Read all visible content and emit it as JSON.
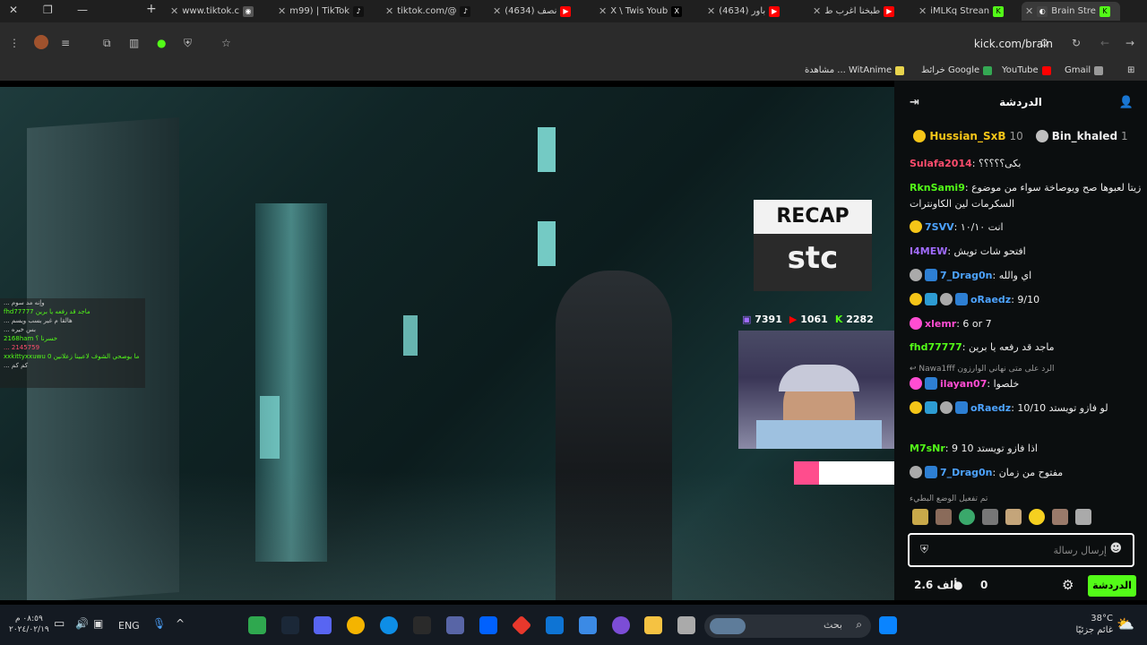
{
  "tabs": [
    {
      "title": "www.tiktok.c",
      "icon": "tiktok-icon"
    },
    {
      "title": "m99) | TikTok",
      "icon": "tiktok-icon"
    },
    {
      "title": "tiktok.com/@",
      "icon": "tiktok-icon"
    },
    {
      "title": "(4634) نصف",
      "icon": "youtube-icon"
    },
    {
      "title": "X \\ Twis Youb",
      "icon": "x-icon"
    },
    {
      "title": "(4634) باور",
      "icon": "youtube-icon"
    },
    {
      "title": "طبخنا اغرب ط",
      "icon": "youtube-icon"
    },
    {
      "title": "iMLKq Strean",
      "icon": "kick-icon"
    },
    {
      "title": "Brain Stre",
      "icon": "kick-icon",
      "active": true
    }
  ],
  "address_bar": {
    "url": "kick.com/brain"
  },
  "bookmarks": [
    {
      "label": "Gmail",
      "icon": "gmail-icon"
    },
    {
      "label": "YouTube",
      "icon": "youtube-icon"
    },
    {
      "label": "خرائط Google",
      "icon": "maps-icon"
    },
    {
      "label": "مشاهدة ... WitAnime",
      "icon": "witanime-icon"
    }
  ],
  "video": {
    "recap_label": "RECAP",
    "sponsor_logo": "stc",
    "stats": {
      "kick": "7391",
      "youtube": "1061",
      "twitch": "2282"
    }
  },
  "overlay_chat": [
    "... وإنه مد سوم",
    "fhd77777 ماجد قد رفعه يا برين",
    "... هالقا م غير بسب ويسم",
    "... بس خيره",
    "2168ham خسرنا ؟",
    "... 2145759",
    "xxkittyxxuwu ما يوصحي الشوف لاعبينا زعلانين 0",
    "... كم كم"
  ],
  "chat": {
    "title": "الدردشة",
    "top_gifters": [
      {
        "name": "Hussian_SxB",
        "count": "10",
        "color": "#f5c518"
      },
      {
        "name": "Bin_khaled",
        "count": "1",
        "color": "#c0c0c0"
      }
    ],
    "messages": [
      {
        "user": "Sulafa2014",
        "text": "بكى؟؟؟؟؟",
        "color": "#ff4d6d"
      },
      {
        "user": "RknSami9",
        "text": "زيتا لعبوها صح ويوصاخة سواء من موضوع السكرمات لين الكاونترات",
        "color": "#53fc18"
      },
      {
        "user": "7SVV",
        "text": "انت ١٠/١٠",
        "color": "#4da3ff"
      },
      {
        "user": "I4MEW",
        "text": "افتحو شات تويش",
        "color": "#a06bff"
      },
      {
        "user": "7_Drag0n",
        "text": "اي والله",
        "color": "#4da3ff"
      },
      {
        "user": "oRaedz",
        "text": "9/10",
        "color": "#4da3ff"
      },
      {
        "user": "xlemr",
        "text": "6 or 7",
        "color": "#ff4dd2"
      },
      {
        "user": "fhd77777",
        "text": "ماجد قد رفعه يا برين",
        "color": "#53fc18"
      },
      {
        "user": "Nawa1fff",
        "text": "الرد على متى نهاني الوارزون",
        "color": "#999"
      },
      {
        "user": "ilayan07",
        "text": "خلصوا",
        "color": "#ff4dd2"
      },
      {
        "user": "oRaedz",
        "text": "لو فازو تويستد 10/10",
        "color": "#4da3ff"
      },
      {
        "user": "M7sNr",
        "text": "اذا فازو تويستد 10 9",
        "color": "#53fc18"
      },
      {
        "user": "7_Drag0n",
        "text": "مفتوح من زمان",
        "color": "#4da3ff"
      },
      {
        "user": "",
        "text": "تم تفعيل الوضع البطيء",
        "color": "#999"
      }
    ],
    "input_placeholder": "إرسال رسالة",
    "followers": "2.6 ألف",
    "points": "0",
    "send_label": "الدردشة"
  },
  "taskbar": {
    "time": "٠٨:٥٩ م",
    "date": "٢٠٢٤/٠٢/١٩",
    "lang": "ENG",
    "search_placeholder": "بحث",
    "weather_temp": "38°C",
    "weather_desc": "غائم جزئيًا"
  }
}
